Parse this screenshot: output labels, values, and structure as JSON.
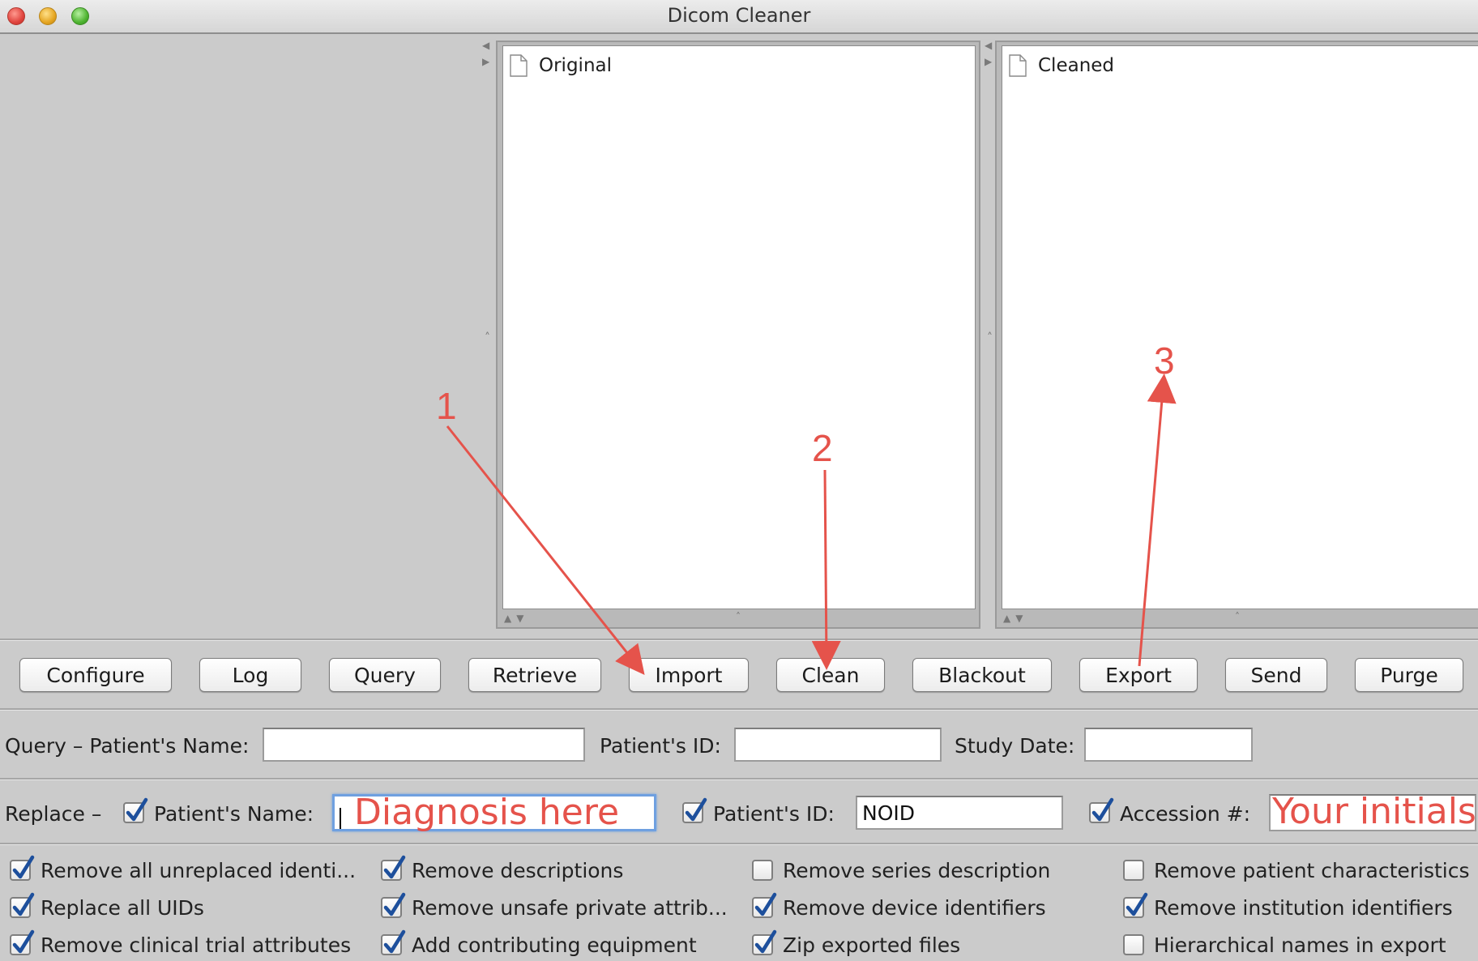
{
  "window": {
    "title": "Dicom Cleaner"
  },
  "panels": {
    "original_label": "Original",
    "cleaned_label": "Cleaned"
  },
  "toolbar": {
    "configure": "Configure",
    "log": "Log",
    "query": "Query",
    "retrieve": "Retrieve",
    "import": "Import",
    "clean": "Clean",
    "blackout": "Blackout",
    "export": "Export",
    "send": "Send",
    "purge": "Purge"
  },
  "query_form": {
    "label_patient_name": "Query – Patient's Name:",
    "patient_name_value": "",
    "label_patient_id": "Patient's ID:",
    "patient_id_value": "",
    "label_study_date": "Study Date:",
    "study_date_value": ""
  },
  "replace_form": {
    "label_replace": "Replace –",
    "patient_name_checked": true,
    "label_patient_name": "Patient's Name:",
    "patient_name_value": "Diagnosis here",
    "patient_id_checked": true,
    "label_patient_id": "Patient's ID:",
    "patient_id_value": "NOID",
    "accession_checked": true,
    "label_accession": "Accession #:",
    "accession_value": "Your initials"
  },
  "options": [
    {
      "label": "Remove all unreplaced identi...",
      "checked": true
    },
    {
      "label": "Remove descriptions",
      "checked": true
    },
    {
      "label": "Remove series description",
      "checked": false
    },
    {
      "label": "Remove patient characteristics",
      "checked": false
    },
    {
      "label": "Replace all UIDs",
      "checked": true
    },
    {
      "label": "Remove unsafe private attrib...",
      "checked": true
    },
    {
      "label": "Remove device identifiers",
      "checked": true
    },
    {
      "label": "Remove institution identifiers",
      "checked": true
    },
    {
      "label": "Remove clinical trial attributes",
      "checked": true
    },
    {
      "label": "Add contributing equipment",
      "checked": true
    },
    {
      "label": "Zip exported files",
      "checked": true
    },
    {
      "label": "Hierarchical names in export",
      "checked": false
    }
  ],
  "annotations": {
    "step1": "1",
    "step2": "2",
    "step3": "3",
    "color": "#e5534b"
  }
}
